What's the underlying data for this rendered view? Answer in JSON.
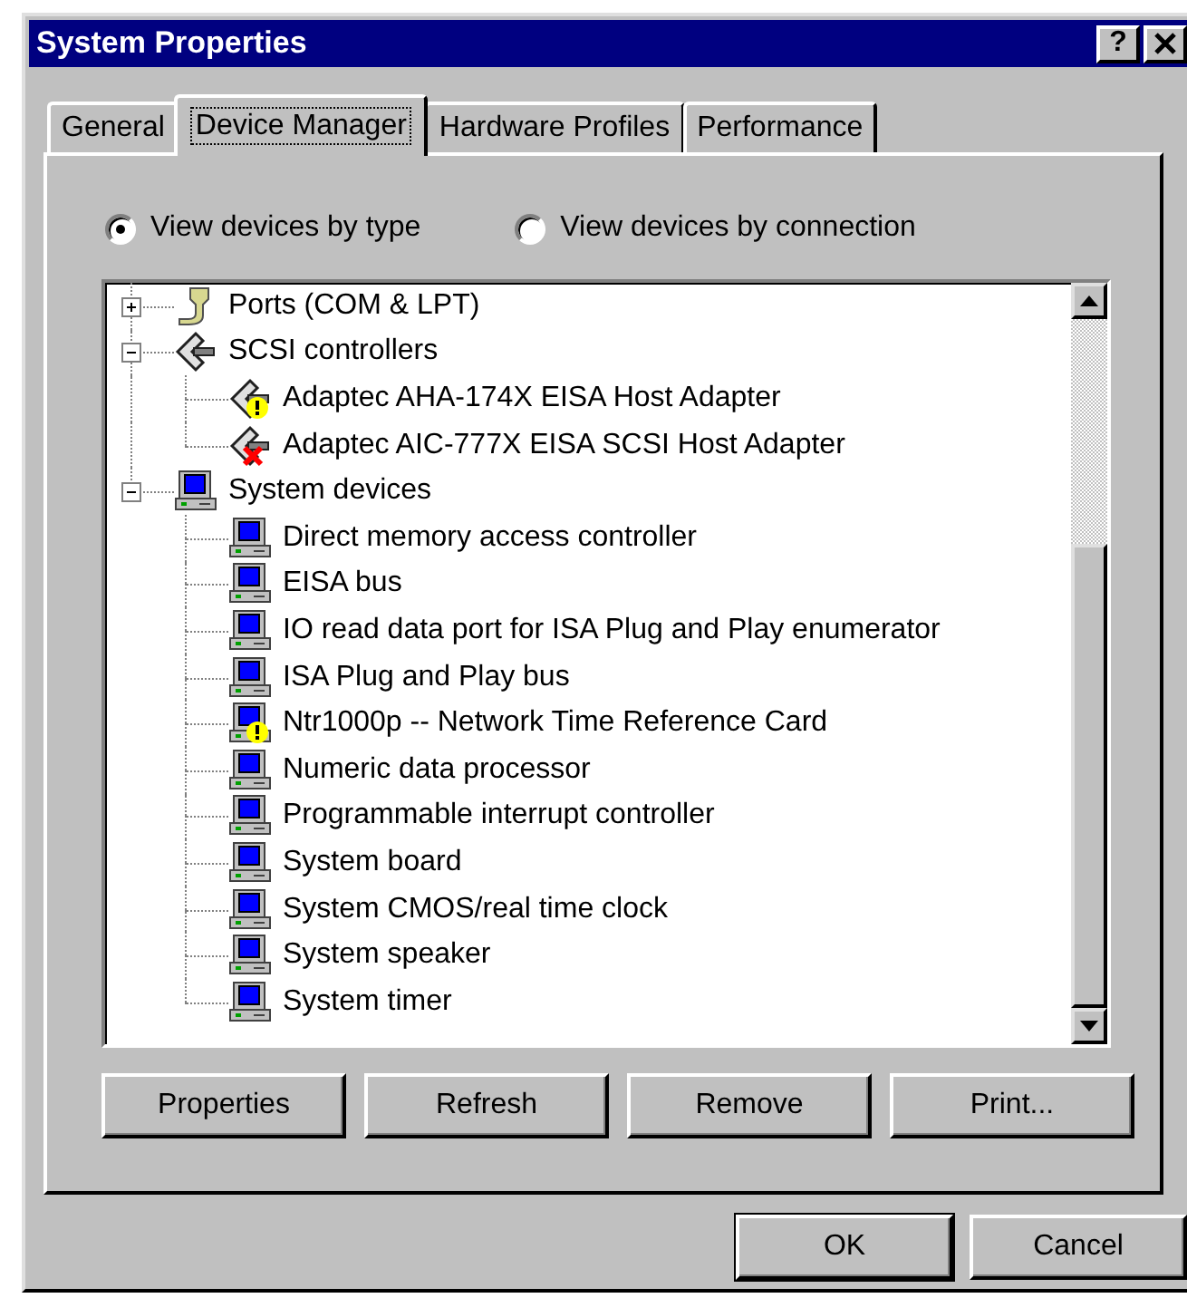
{
  "window": {
    "title": "System Properties",
    "help_button": "?"
  },
  "tabs": [
    {
      "label": "General",
      "selected": false
    },
    {
      "label": "Device Manager",
      "selected": true
    },
    {
      "label": "Hardware Profiles",
      "selected": false
    },
    {
      "label": "Performance",
      "selected": false
    }
  ],
  "view_options": [
    {
      "label": "View devices by type",
      "selected": true
    },
    {
      "label": "View devices by connection",
      "selected": false
    }
  ],
  "device_tree": [
    {
      "label": "Ports (COM & LPT)",
      "kind": "port",
      "warning": false,
      "error": false,
      "expanded": false
    },
    {
      "label": "SCSI controllers",
      "kind": "scsi",
      "warning": false,
      "error": false,
      "expanded": true,
      "children": [
        {
          "label": "Adaptec AHA-174X EISA Host Adapter",
          "kind": "scsi",
          "warning": true,
          "error": false
        },
        {
          "label": "Adaptec AIC-777X EISA SCSI Host Adapter",
          "kind": "scsi",
          "warning": false,
          "error": true
        }
      ]
    },
    {
      "label": "System devices",
      "kind": "computer",
      "warning": false,
      "error": false,
      "expanded": true,
      "children": [
        {
          "label": "Direct memory access controller",
          "kind": "computer",
          "warning": false,
          "error": false
        },
        {
          "label": "EISA bus",
          "kind": "computer",
          "warning": false,
          "error": false
        },
        {
          "label": "IO read data port for ISA Plug and Play enumerator",
          "kind": "computer",
          "warning": false,
          "error": false
        },
        {
          "label": "ISA Plug and Play bus",
          "kind": "computer",
          "warning": false,
          "error": false
        },
        {
          "label": "Ntr1000p -- Network Time Reference Card",
          "kind": "computer",
          "warning": true,
          "error": false
        },
        {
          "label": "Numeric data processor",
          "kind": "computer",
          "warning": false,
          "error": false
        },
        {
          "label": "Programmable interrupt controller",
          "kind": "computer",
          "warning": false,
          "error": false
        },
        {
          "label": "System board",
          "kind": "computer",
          "warning": false,
          "error": false
        },
        {
          "label": "System CMOS/real time clock",
          "kind": "computer",
          "warning": false,
          "error": false
        },
        {
          "label": "System speaker",
          "kind": "computer",
          "warning": false,
          "error": false
        },
        {
          "label": "System timer",
          "kind": "computer",
          "warning": false,
          "error": false
        }
      ]
    }
  ],
  "device_buttons": [
    "Properties",
    "Refresh",
    "Remove",
    "Print..."
  ],
  "dialog_buttons": [
    {
      "label": "OK",
      "default": true
    },
    {
      "label": "Cancel",
      "default": false
    }
  ]
}
